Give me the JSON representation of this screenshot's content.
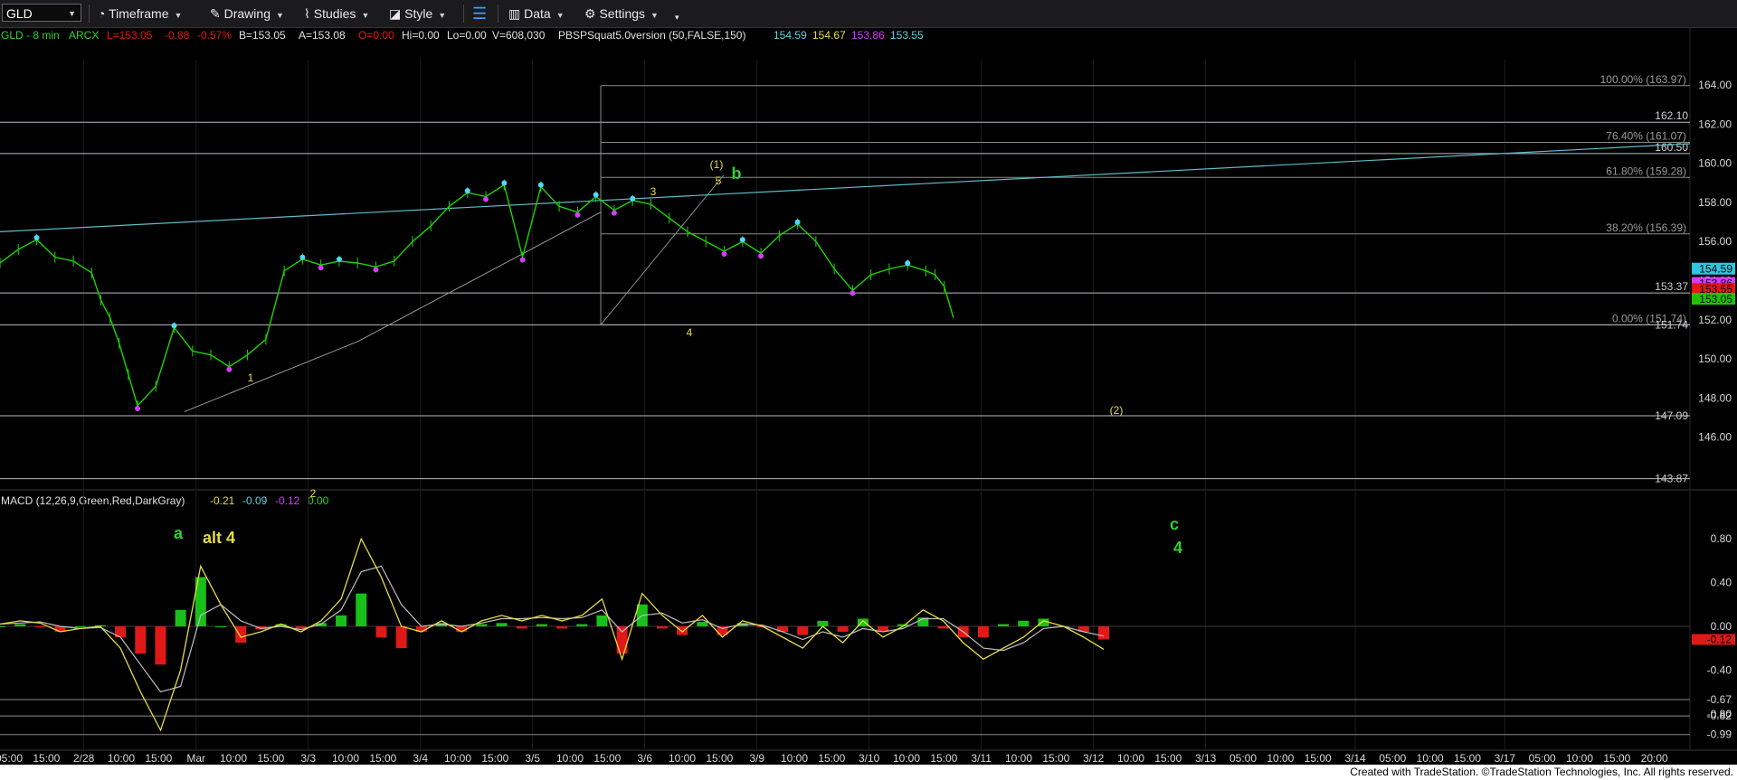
{
  "toolbar": {
    "symbol": "GLD",
    "timeframe": "Timeframe",
    "drawing": "Drawing",
    "studies": "Studies",
    "style": "Style",
    "data": "Data",
    "settings": "Settings"
  },
  "legend": {
    "symbol_tf": "GLD - 8 min",
    "exchange": "ARCX",
    "last": "L=153.05",
    "change": "-0.88",
    "pct": "-0.57%",
    "bid": "B=153.05",
    "ask": "A=153.08",
    "open": "O=0.00",
    "high": "Hi=0.00",
    "low": "Lo=0.00",
    "volume": "V=608,030",
    "study": "PBSPSquat5.0version (50,FALSE,150)",
    "v1": "154.59",
    "v2": "154.67",
    "v3": "153.86",
    "v4": "153.55"
  },
  "macd_legend": {
    "name": "MACD (12,26,9,Green,Red,DarkGray)",
    "v1": "-0.21",
    "v2": "-0.09",
    "v3": "-0.12",
    "v4": "0.00"
  },
  "colors": {
    "price": "#1fd400",
    "swing_high": "#52d7ff",
    "swing_low": "#d43cff",
    "hline": "#b9bcc8",
    "trendline": "#5fbcc8",
    "wave_yellow": "#e7dc45",
    "wave_green": "#2fd12f",
    "macd": "#e7dc45",
    "signal": "#bfbfbf",
    "hist_up": "#19c019",
    "hist_down": "#e01818"
  },
  "footer": "Created with TradeStation. ©TradeStation Technologies, Inc. All rights reserved.",
  "chart_data": {
    "type": "line",
    "symbol": "GLD",
    "interval": "8 min",
    "y_axis_ticks": [
      "164.00",
      "162.00",
      "160.00",
      "158.00",
      "156.00",
      "154.00",
      "152.00",
      "150.00",
      "148.00",
      "146.00"
    ],
    "ylim": [
      143.3,
      165.3
    ],
    "x_axis_labels": [
      "05:00",
      "15:00",
      "2/28",
      "10:00",
      "15:00",
      "Mar",
      "10:00",
      "15:00",
      "3/3",
      "10:00",
      "15:00",
      "3/4",
      "10:00",
      "15:00",
      "3/5",
      "10:00",
      "15:00",
      "3/6",
      "10:00",
      "15:00",
      "3/9",
      "10:00",
      "15:00",
      "3/10",
      "10:00",
      "15:00",
      "3/11",
      "10:00",
      "15:00",
      "3/12",
      "10:00",
      "15:00",
      "3/13",
      "05:00",
      "10:00",
      "15:00",
      "3/14",
      "05:00",
      "10:00",
      "15:00",
      "3/17",
      "05:00",
      "10:00",
      "15:00",
      "20:00"
    ],
    "price_series": {
      "x": [
        0,
        2,
        4,
        6,
        8,
        10,
        11,
        12,
        13,
        14,
        15,
        17,
        19,
        21,
        23,
        25,
        27,
        29,
        31,
        33,
        35,
        37,
        39,
        41,
        43,
        45,
        47,
        49,
        51,
        53,
        55,
        57,
        59,
        61,
        63,
        65,
        67,
        69,
        71,
        73,
        75,
        77,
        79,
        81,
        83,
        85,
        87,
        89,
        91,
        93,
        95,
        97,
        99,
        101,
        102,
        103,
        104,
        106,
        108,
        109,
        110
      ],
      "y": [
        154.9,
        155.6,
        156.1,
        155.2,
        155.0,
        154.4,
        153.0,
        152.1,
        150.8,
        149.2,
        147.6,
        148.6,
        151.6,
        150.4,
        150.2,
        149.6,
        150.2,
        151.0,
        154.5,
        155.1,
        154.8,
        155.0,
        154.9,
        154.7,
        155.0,
        156.0,
        156.8,
        157.8,
        158.5,
        158.3,
        158.9,
        155.2,
        158.8,
        157.8,
        157.5,
        158.3,
        157.6,
        158.1,
        157.9,
        157.2,
        156.5,
        156.0,
        155.5,
        156.0,
        155.4,
        156.3,
        156.9,
        156.0,
        154.6,
        153.5,
        154.3,
        154.6,
        154.8,
        154.5,
        154.3,
        153.7,
        152.1,
        153.05,
        153.05,
        153.05,
        153.05
      ]
    },
    "horizontal_levels": [
      {
        "label": "100.00% (163.97)",
        "value": 163.97
      },
      {
        "label": "162.10",
        "value": 162.1
      },
      {
        "label": "76.40% (161.07)",
        "value": 161.07
      },
      {
        "label": "160.50",
        "value": 160.5
      },
      {
        "label": "61.80% (159.28)",
        "value": 159.28
      },
      {
        "label": "38.20% (156.39)",
        "value": 156.39
      },
      {
        "label": "153.37",
        "value": 153.37
      },
      {
        "label": "0.00% (151.74)",
        "value": 151.74
      },
      {
        "label": "151.74",
        "value": 151.74
      },
      {
        "label": "147.09",
        "value": 147.09
      },
      {
        "label": "143.87",
        "value": 143.87
      }
    ],
    "price_tags": [
      {
        "value": "154.59",
        "price": 154.59,
        "color": "#2ec6e0"
      },
      {
        "value": "153.86",
        "price": 153.86,
        "color": "#d43cff"
      },
      {
        "value": "153.55",
        "price": 153.55,
        "color": "#e01818"
      },
      {
        "value": "153.05",
        "price": 153.05,
        "color": "#1fc400"
      }
    ],
    "wave_labels": [
      {
        "text": "a",
        "color": "green"
      },
      {
        "text": "alt 4",
        "color": "yellow"
      },
      {
        "text": "1",
        "color": "yellow"
      },
      {
        "text": "2",
        "color": "yellow"
      },
      {
        "text": "3",
        "color": "yellow"
      },
      {
        "text": "4",
        "color": "yellow"
      },
      {
        "text": "5",
        "color": "yellow"
      },
      {
        "text": "(1)",
        "color": "yellow"
      },
      {
        "text": "b",
        "color": "green"
      },
      {
        "text": "(2)",
        "color": "yellow"
      },
      {
        "text": "c",
        "color": "green"
      },
      {
        "text": "4",
        "color": "green"
      }
    ],
    "macd": {
      "params": "(12,26,9,Green,Red,DarkGray)",
      "y_axis_ticks": [
        "0.80",
        "0.40",
        "-0.40",
        "-0.80"
      ],
      "ylim": [
        -1.05,
        0.95
      ],
      "macd_series": [
        0.02,
        0.05,
        0.03,
        -0.05,
        -0.02,
        0.0,
        -0.2,
        -0.6,
        -0.95,
        -0.4,
        0.55,
        0.2,
        -0.1,
        -0.05,
        0.02,
        -0.05,
        0.05,
        0.25,
        0.8,
        0.45,
        0.0,
        -0.05,
        0.05,
        -0.05,
        0.05,
        0.1,
        0.05,
        0.1,
        0.05,
        0.1,
        0.25,
        -0.3,
        0.3,
        0.1,
        -0.05,
        0.1,
        -0.1,
        0.05,
        0.0,
        -0.1,
        -0.2,
        0.0,
        -0.15,
        0.05,
        -0.1,
        0.0,
        0.15,
        0.05,
        -0.15,
        -0.3,
        -0.2,
        -0.1,
        0.05,
        0.0,
        -0.1,
        -0.21
      ],
      "signal_series": [
        0.02,
        0.03,
        0.04,
        0.0,
        -0.02,
        -0.01,
        -0.1,
        -0.35,
        -0.6,
        -0.55,
        0.1,
        0.2,
        0.05,
        -0.02,
        0.0,
        -0.03,
        0.02,
        0.15,
        0.5,
        0.55,
        0.2,
        0.0,
        0.02,
        0.0,
        0.03,
        0.07,
        0.07,
        0.08,
        0.07,
        0.08,
        0.15,
        -0.05,
        0.1,
        0.12,
        0.03,
        0.06,
        -0.02,
        0.02,
        0.01,
        -0.05,
        -0.12,
        -0.05,
        -0.1,
        -0.02,
        -0.05,
        -0.02,
        0.07,
        0.07,
        -0.05,
        -0.2,
        -0.22,
        -0.15,
        -0.02,
        0.0,
        -0.05,
        -0.09
      ],
      "axis_tags": [
        {
          "label": "0.00",
          "value": 0.0,
          "color": "#8c8c8c"
        },
        {
          "label": "-0.12",
          "value": -0.12,
          "color": "#e01818"
        },
        {
          "label": "-0.67",
          "value": -0.67,
          "color": "#b9bcc8"
        },
        {
          "label": "-0.82",
          "value": -0.82,
          "color": "#b9bcc8"
        },
        {
          "label": "-0.99",
          "value": -0.99,
          "color": "#b9bcc8"
        }
      ]
    }
  }
}
